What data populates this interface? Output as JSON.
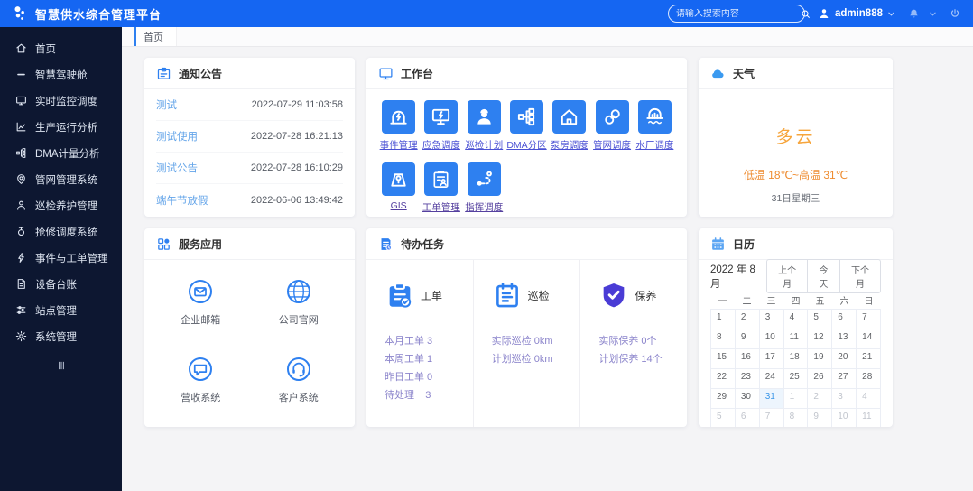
{
  "colors": {
    "header_bg": "#1566f2",
    "sidebar_bg": "#0d1731",
    "accent": "#2e80f0",
    "link": "#4b51d4",
    "visited_link": "#55409f",
    "notice_link": "#63a4e9",
    "weather_main": "#f6a53c",
    "weather_temp": "#ee8b2f",
    "todo_text": "#8b84cb",
    "today": "#3c97e8"
  },
  "header": {
    "title": "智慧供水综合管理平台",
    "search_placeholder": "请输入搜索内容",
    "username": "admin888"
  },
  "tabbar": {
    "active_tab": "首页"
  },
  "sidebar": {
    "items": [
      {
        "label": "首页",
        "icon": "home"
      },
      {
        "label": "智慧驾驶舱",
        "icon": "dash"
      },
      {
        "label": "实时监控调度",
        "icon": "monitor"
      },
      {
        "label": "生产运行分析",
        "icon": "chart"
      },
      {
        "label": "DMA计量分析",
        "icon": "dma"
      },
      {
        "label": "管网管理系统",
        "icon": "pin"
      },
      {
        "label": "巡检养护管理",
        "icon": "person"
      },
      {
        "label": "抢修调度系统",
        "icon": "valve"
      },
      {
        "label": "事件与工单管理",
        "icon": "bolt"
      },
      {
        "label": "设备台账",
        "icon": "file"
      },
      {
        "label": "站点管理",
        "icon": "sliders"
      },
      {
        "label": "系统管理",
        "icon": "gear"
      }
    ]
  },
  "notice": {
    "title": "通知公告",
    "items": [
      {
        "title": "测试",
        "time": "2022-07-29 11:03:58"
      },
      {
        "title": "测试使用",
        "time": "2022-07-28 16:21:13"
      },
      {
        "title": "测试公告",
        "time": "2022-07-28 16:10:29"
      },
      {
        "title": "端午节放假",
        "time": "2022-06-06 13:49:42"
      }
    ]
  },
  "workbench": {
    "title": "工作台",
    "apps": [
      {
        "label": "事件管理",
        "icon": "alarm",
        "visited": false
      },
      {
        "label": "应急调度",
        "icon": "monitor-bolt",
        "visited": false
      },
      {
        "label": "巡检计划",
        "icon": "worker",
        "visited": false
      },
      {
        "label": "DMA分区",
        "icon": "tree",
        "visited": false
      },
      {
        "label": "泵房调度",
        "icon": "house",
        "visited": false
      },
      {
        "label": "管网调度",
        "icon": "chain",
        "visited": false
      },
      {
        "label": "水厂调度",
        "icon": "plant",
        "visited": false
      },
      {
        "label": "GIS",
        "icon": "gis",
        "visited": true
      },
      {
        "label": "工单管理",
        "icon": "clipboard-user",
        "visited": true
      },
      {
        "label": "指挥调度",
        "icon": "route",
        "visited": true
      }
    ]
  },
  "weather": {
    "title": "天气",
    "condition": "多云",
    "temp_range": "低温 18℃~高温 31℃",
    "date": "31日星期三"
  },
  "services": {
    "title": "服务应用",
    "apps": [
      {
        "label": "企业邮箱",
        "icon": "mail"
      },
      {
        "label": "公司官网",
        "icon": "globe"
      },
      {
        "label": "营收系统",
        "icon": "chat"
      },
      {
        "label": "客户系统",
        "icon": "headset"
      }
    ]
  },
  "todo": {
    "title": "待办任务",
    "sections": [
      {
        "label": "工单",
        "icon": "workorder",
        "lines": [
          "本月工单 3",
          "本周工单 1",
          "昨日工单 0",
          "待处理    3"
        ]
      },
      {
        "label": "巡检",
        "icon": "inspect",
        "lines": [
          "实际巡检 0km",
          "计划巡检 0km"
        ]
      },
      {
        "label": "保养",
        "icon": "shield",
        "lines": [
          "实际保养 0个",
          "计划保养 14个"
        ]
      }
    ]
  },
  "calendar": {
    "title": "日历",
    "month_label": "2022 年 8 月",
    "buttons": [
      "上个月",
      "今天",
      "下个月"
    ],
    "weekdays": [
      "一",
      "二",
      "三",
      "四",
      "五",
      "六",
      "日"
    ],
    "cells": [
      {
        "d": 1,
        "s": "n"
      },
      {
        "d": 2,
        "s": "n"
      },
      {
        "d": 3,
        "s": "n"
      },
      {
        "d": 4,
        "s": "n"
      },
      {
        "d": 5,
        "s": "n"
      },
      {
        "d": 6,
        "s": "n"
      },
      {
        "d": 7,
        "s": "n"
      },
      {
        "d": 8,
        "s": "n"
      },
      {
        "d": 9,
        "s": "n"
      },
      {
        "d": 10,
        "s": "n"
      },
      {
        "d": 11,
        "s": "n"
      },
      {
        "d": 12,
        "s": "n"
      },
      {
        "d": 13,
        "s": "n"
      },
      {
        "d": 14,
        "s": "n"
      },
      {
        "d": 15,
        "s": "n"
      },
      {
        "d": 16,
        "s": "n"
      },
      {
        "d": 17,
        "s": "n"
      },
      {
        "d": 18,
        "s": "n"
      },
      {
        "d": 19,
        "s": "n"
      },
      {
        "d": 20,
        "s": "n"
      },
      {
        "d": 21,
        "s": "n"
      },
      {
        "d": 22,
        "s": "n"
      },
      {
        "d": 23,
        "s": "n"
      },
      {
        "d": 24,
        "s": "n"
      },
      {
        "d": 25,
        "s": "n"
      },
      {
        "d": 26,
        "s": "n"
      },
      {
        "d": 27,
        "s": "n"
      },
      {
        "d": 28,
        "s": "n"
      },
      {
        "d": 29,
        "s": "n"
      },
      {
        "d": 30,
        "s": "n"
      },
      {
        "d": 31,
        "s": "t"
      },
      {
        "d": 1,
        "s": "m"
      },
      {
        "d": 2,
        "s": "m"
      },
      {
        "d": 3,
        "s": "m"
      },
      {
        "d": 4,
        "s": "m"
      },
      {
        "d": 5,
        "s": "m"
      },
      {
        "d": 6,
        "s": "m"
      },
      {
        "d": 7,
        "s": "m"
      },
      {
        "d": 8,
        "s": "m"
      },
      {
        "d": 9,
        "s": "m"
      },
      {
        "d": 10,
        "s": "m"
      },
      {
        "d": 11,
        "s": "m"
      }
    ]
  }
}
